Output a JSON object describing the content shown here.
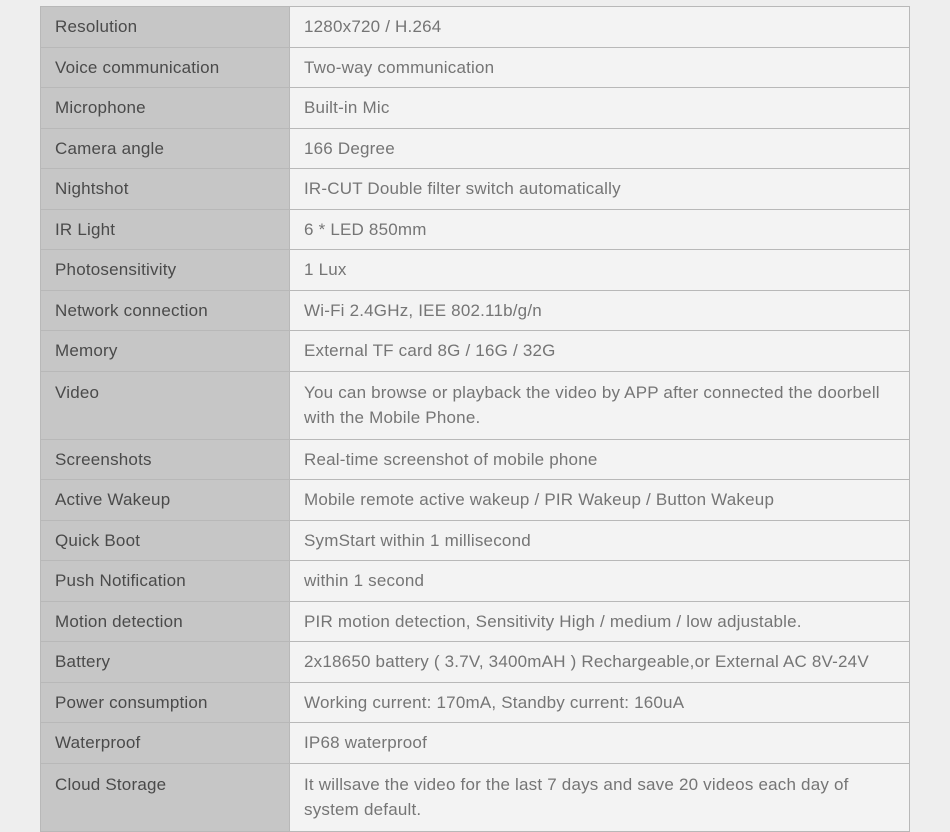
{
  "specs": [
    {
      "label": "Resolution",
      "value": "1280x720 / H.264"
    },
    {
      "label": "Voice communication",
      "value": "Two-way communication"
    },
    {
      "label": "Microphone",
      "value": "Built-in Mic"
    },
    {
      "label": "Camera angle",
      "value": "166 Degree"
    },
    {
      "label": "Nightshot",
      "value": "IR-CUT Double filter switch automatically"
    },
    {
      "label": "IR Light",
      "value": "6 * LED 850mm"
    },
    {
      "label": "Photosensitivity",
      "value": "1 Lux"
    },
    {
      "label": "Network connection",
      "value": "Wi-Fi 2.4GHz, IEE 802.11b/g/n"
    },
    {
      "label": "Memory",
      "value": "External TF card 8G / 16G / 32G"
    },
    {
      "label": "Video",
      "value": "You can browse or playback the video by APP after connected the doorbell with the Mobile Phone."
    },
    {
      "label": "Screenshots",
      "value": "Real-time screenshot of mobile phone"
    },
    {
      "label": "Active Wakeup",
      "value": "Mobile remote active wakeup / PIR Wakeup / Button Wakeup"
    },
    {
      "label": "Quick Boot",
      "value": "SymStart within 1 millisecond"
    },
    {
      "label": "Push Notification",
      "value": "within 1 second"
    },
    {
      "label": "Motion detection",
      "value": "PIR motion detection, Sensitivity High / medium / low adjustable."
    },
    {
      "label": "Battery",
      "value": "2x18650 battery ( 3.7V, 3400mAH ) Rechargeable,or External AC 8V-24V"
    },
    {
      "label": "Power consumption",
      "value": "Working current: 170mA, Standby current: 160uA"
    },
    {
      "label": "Waterproof",
      "value": "IP68 waterproof"
    },
    {
      "label": "Cloud Storage",
      "value": "It willsave the video for the last 7 days and save 20 videos each day of system default."
    }
  ]
}
